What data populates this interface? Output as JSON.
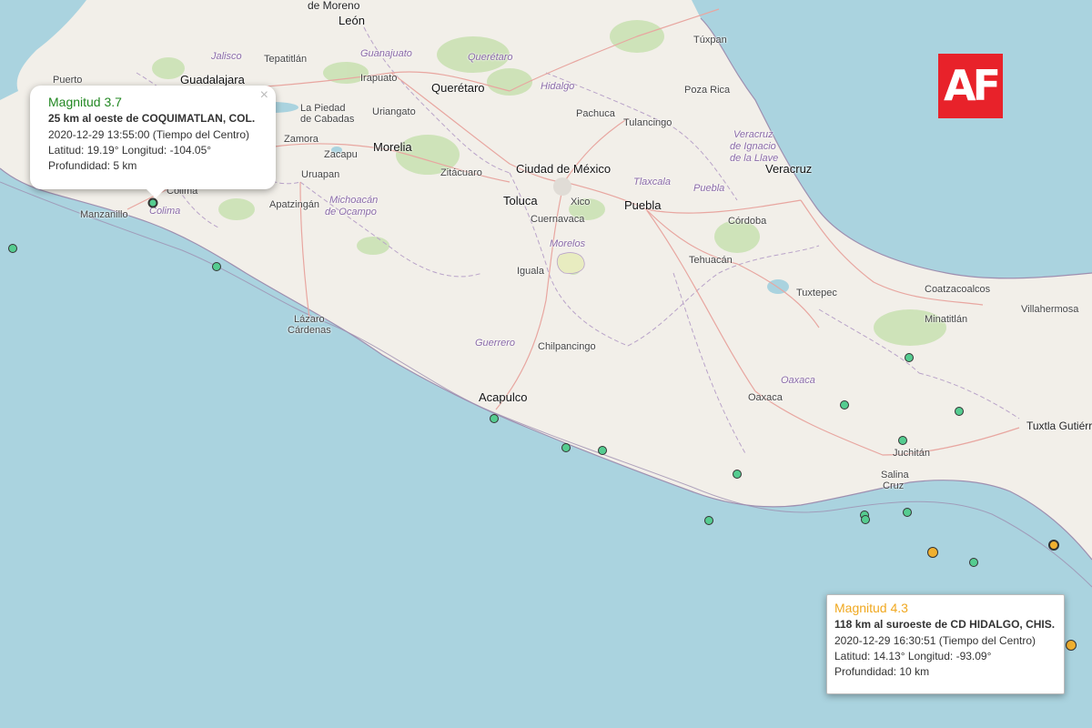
{
  "colors": {
    "ocean": "#aad3df",
    "land": "#f2efe9",
    "forest": "#c8e0b0",
    "green_marker": "#55cc90",
    "orange_marker": "#f0b030",
    "popup1_title": "#228822",
    "popup2_title": "#f0a820",
    "logo_bg": "#e8222a"
  },
  "logo": {
    "text": "AF"
  },
  "popup_west": {
    "magnitude": "Magnitud 3.7",
    "place": "25 km al oeste de COQUIMATLAN, COL.",
    "datetime": "2020-12-29  13:55:00 (Tiempo del Centro)",
    "coords": "Latitud: 19.19°  Longitud: -104.05°",
    "depth": "Profundidad: 5 km",
    "close": "×"
  },
  "popup_east": {
    "magnitude": "Magnitud 4.3",
    "place": "118 km al suroeste de CD HIDALGO, CHIS.",
    "datetime": "2020-12-29  16:30:51 (Tiempo del Centro)",
    "coords": "Latitud: 14.13°  Longitud: -93.09°",
    "depth": "Profundidad: 10 km"
  },
  "labels": {
    "moreno": "de Moreno",
    "leon": "León",
    "tuxpan": "Túxpan",
    "jalisco": "Jalisco",
    "tepatitlan": "Tepatitlán",
    "guanajuato": "Guanajuato",
    "queretaro_state": "Querétaro",
    "puerto": "Puerto",
    "guadalajara": "Guadalajara",
    "irapuato": "Irapuato",
    "queretaro": "Querétaro",
    "hidalgo": "Hidalgo",
    "poza_rica": "Poza Rica",
    "la_piedad": "La Piedad",
    "de_cabadas": "de Cabadas",
    "uriangato": "Uriangato",
    "pachuca": "Pachuca",
    "tulancingo": "Tulancingo",
    "zamora": "Zamora",
    "morelia": "Morelia",
    "veracruz_state1": "Veracruz",
    "veracruz_state2": "de Ignacio",
    "veracruz_state3": "de la Llave",
    "zacapu": "Zacapu",
    "uruapan": "Uruapan",
    "zitacuaro": "Zitácuaro",
    "ciudad_mexico": "Ciudad de México",
    "veracruz": "Veracruz",
    "tlaxcala": "Tlaxcala",
    "puebla_state": "Puebla",
    "colima_city": "Colima",
    "michoacan1": "Michoacán",
    "michoacan2": "de Ocampo",
    "apatzingan": "Apatzingán",
    "toluca": "Toluca",
    "xico": "Xico",
    "puebla": "Puebla",
    "colima_state": "Colima",
    "manzanillo": "Manzanillo",
    "cuernavaca": "Cuernavaca",
    "cordoba": "Córdoba",
    "morelos": "Morelos",
    "iguala": "Iguala",
    "tehuacan": "Tehuacán",
    "tuxtepec": "Tuxtepec",
    "coatzacoalcos": "Coatzacoalcos",
    "lazaro1": "Lázaro",
    "lazaro2": "Cárdenas",
    "minatitlan": "Minatitlán",
    "villahermosa": "Villahermosa",
    "guerrero": "Guerrero",
    "chilpancingo": "Chilpancingo",
    "oaxaca_state": "Oaxaca",
    "oaxaca": "Oaxaca",
    "acapulco": "Acapulco",
    "tuxtla": "Tuxtla Gutiérrez",
    "juchitan": "Juchitán",
    "salina1": "Salina",
    "salina2": "Cruz"
  }
}
